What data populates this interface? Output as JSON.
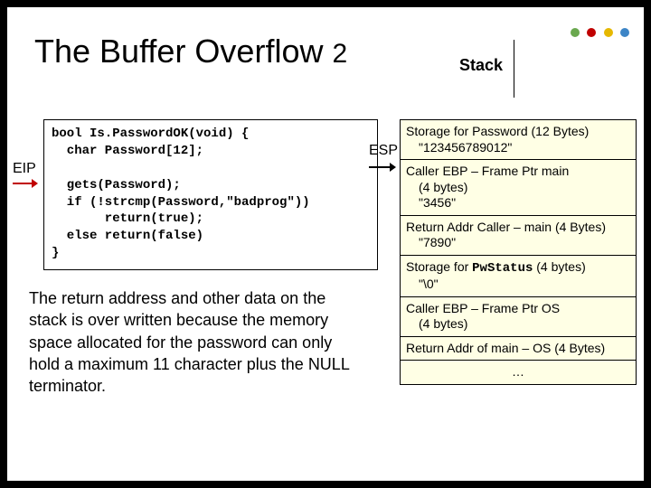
{
  "title": {
    "main": "The Buffer Overflow",
    "n": "2"
  },
  "stack_header": "Stack",
  "eip_label": "EIP",
  "esp_label": "ESP",
  "code": {
    "l1": "bool Is.PasswordOK(void) {",
    "l2": "  char Password[12];",
    "l3": "",
    "l4": "  gets(Password);",
    "l5": "  if (!strcmp(Password,\"badprog\"))",
    "l6": "       return(true);",
    "l7": "  else return(false)",
    "l8": "}"
  },
  "stack": {
    "r0a": "Storage for Password (12 Bytes)",
    "r0b": "\"123456789012\"",
    "r1a": "Caller EBP – Frame Ptr main",
    "r1b": "(4 bytes)",
    "r1c": "\"3456\"",
    "r2a": "Return Addr Caller – main (4 Bytes)",
    "r2b": "\"7890\"",
    "r3a_pre": "Storage for ",
    "r3a_mono": "PwStatus",
    "r3a_post": " (4 bytes)",
    "r3b": "\"\\0\"",
    "r4a": "Caller EBP – Frame Ptr OS",
    "r4b": "(4 bytes)",
    "r5": "Return Addr of main – OS (4 Bytes)",
    "r6": "…"
  },
  "paragraph": "The return address and other data on the stack is over written because the memory space allocated for the password can only hold a maximum 11 character plus the NULL terminator.",
  "dot_colors": [
    "#6aa84f",
    "#c00000",
    "#e6b800",
    "#3d85c6"
  ]
}
